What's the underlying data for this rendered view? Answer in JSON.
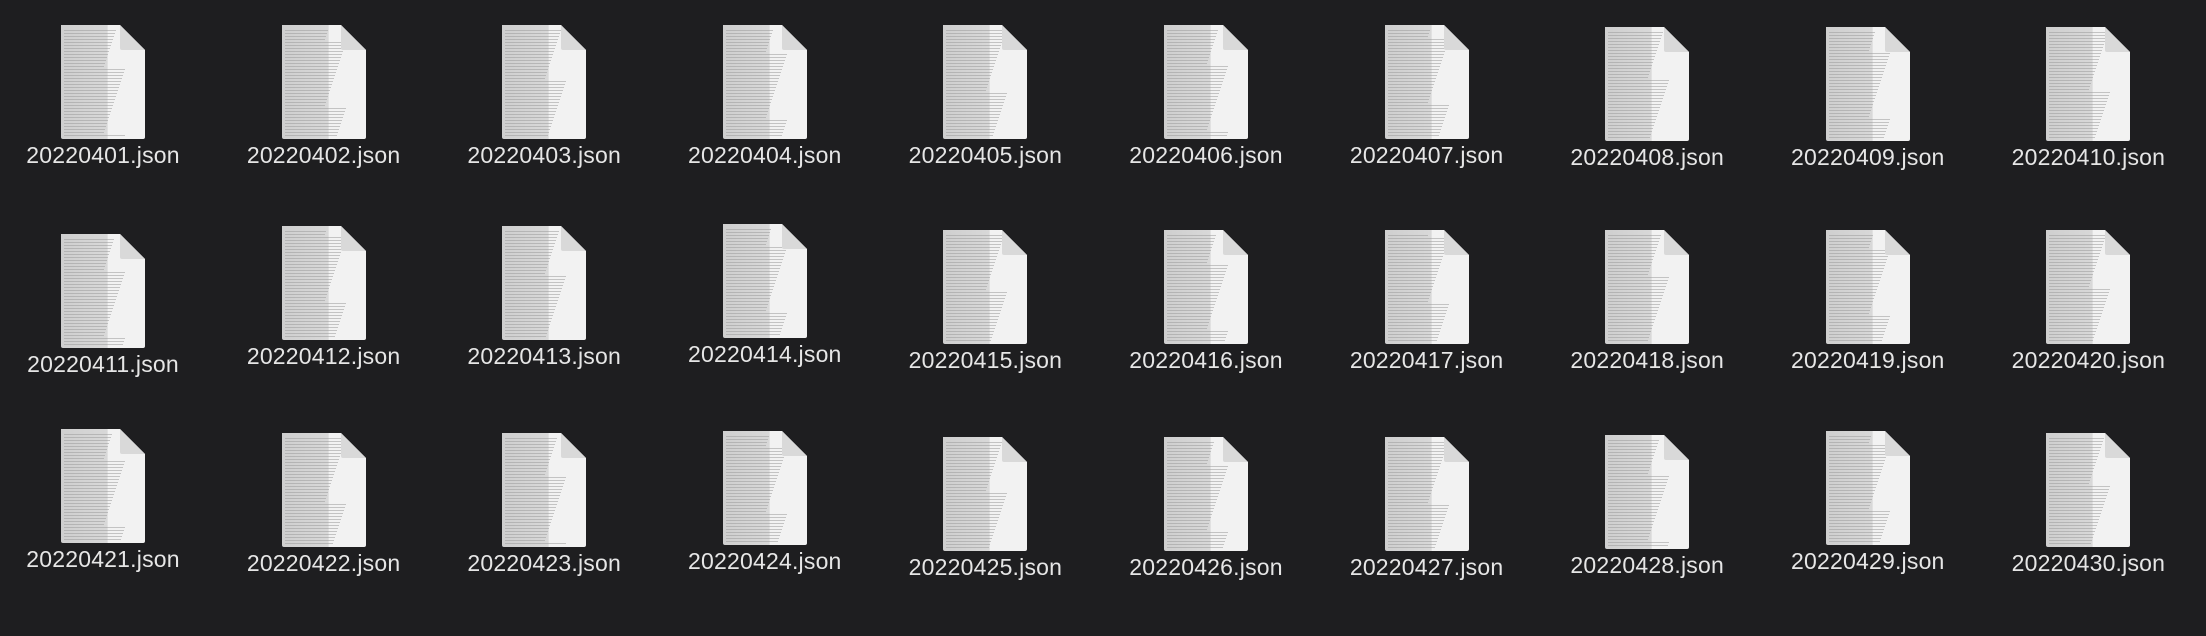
{
  "window": {
    "view": "icon-grid"
  },
  "files": [
    {
      "name": "20220401.json",
      "icon": "json-file-icon"
    },
    {
      "name": "20220402.json",
      "icon": "json-file-icon"
    },
    {
      "name": "20220403.json",
      "icon": "json-file-icon"
    },
    {
      "name": "20220404.json",
      "icon": "json-file-icon"
    },
    {
      "name": "20220405.json",
      "icon": "json-file-icon"
    },
    {
      "name": "20220406.json",
      "icon": "json-file-icon"
    },
    {
      "name": "20220407.json",
      "icon": "json-file-icon"
    },
    {
      "name": "20220408.json",
      "icon": "json-file-icon"
    },
    {
      "name": "20220409.json",
      "icon": "json-file-icon"
    },
    {
      "name": "20220410.json",
      "icon": "json-file-icon"
    },
    {
      "name": "20220411.json",
      "icon": "json-file-icon"
    },
    {
      "name": "20220412.json",
      "icon": "json-file-icon"
    },
    {
      "name": "20220413.json",
      "icon": "json-file-icon"
    },
    {
      "name": "20220414.json",
      "icon": "json-file-icon"
    },
    {
      "name": "20220415.json",
      "icon": "json-file-icon"
    },
    {
      "name": "20220416.json",
      "icon": "json-file-icon"
    },
    {
      "name": "20220417.json",
      "icon": "json-file-icon"
    },
    {
      "name": "20220418.json",
      "icon": "json-file-icon"
    },
    {
      "name": "20220419.json",
      "icon": "json-file-icon"
    },
    {
      "name": "20220420.json",
      "icon": "json-file-icon"
    },
    {
      "name": "20220421.json",
      "icon": "json-file-icon"
    },
    {
      "name": "20220422.json",
      "icon": "json-file-icon"
    },
    {
      "name": "20220423.json",
      "icon": "json-file-icon"
    },
    {
      "name": "20220424.json",
      "icon": "json-file-icon"
    },
    {
      "name": "20220425.json",
      "icon": "json-file-icon"
    },
    {
      "name": "20220426.json",
      "icon": "json-file-icon"
    },
    {
      "name": "20220427.json",
      "icon": "json-file-icon"
    },
    {
      "name": "20220428.json",
      "icon": "json-file-icon"
    },
    {
      "name": "20220429.json",
      "icon": "json-file-icon"
    },
    {
      "name": "20220430.json",
      "icon": "json-file-icon"
    }
  ],
  "colors": {
    "background": "#1e1e20",
    "label": "#e6e6e6",
    "page": "#f2f2f2",
    "fold": "#d9d9d9"
  }
}
